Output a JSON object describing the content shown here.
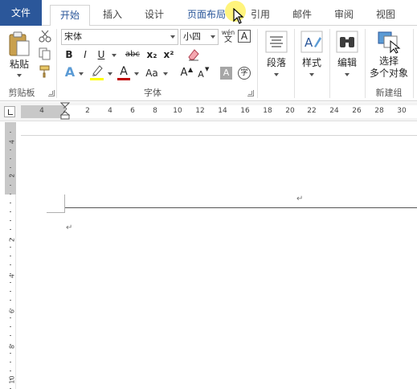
{
  "tabs": [
    {
      "label": "文件"
    },
    {
      "label": "开始"
    },
    {
      "label": "插入"
    },
    {
      "label": "设计"
    },
    {
      "label": "页面布局"
    },
    {
      "label": "引用"
    },
    {
      "label": "邮件"
    },
    {
      "label": "审阅"
    },
    {
      "label": "视图"
    }
  ],
  "ribbon": {
    "clipboard": {
      "paste_label": "粘贴",
      "group_label": "剪贴板"
    },
    "font": {
      "font_name": "宋体",
      "font_size": "小四",
      "bold": "B",
      "italic": "I",
      "underline": "U",
      "strikethrough": "abc",
      "subscript": "x₂",
      "superscript": "x²",
      "change_case": "Aa",
      "grow_font": "A",
      "shrink_font": "A",
      "group_label": "字体",
      "highlight_color": "#ffff00",
      "font_color": "#c00000"
    },
    "paragraph": {
      "label": "段落"
    },
    "styles": {
      "label": "样式"
    },
    "editing": {
      "label": "编辑"
    },
    "new_group": {
      "select_label_line1": "选择",
      "select_label_line2": "多个对象",
      "group_label": "新建组"
    }
  },
  "ruler": {
    "numbers": [
      "4",
      "2",
      "2",
      "4",
      "6",
      "8",
      "10",
      "12",
      "14",
      "16",
      "18",
      "20",
      "22",
      "24",
      "26",
      "28",
      "30"
    ]
  },
  "vertical_ruler": {
    "numbers": [
      "4",
      "2",
      "2",
      "4",
      "6",
      "8",
      "10"
    ]
  },
  "colors": {
    "accent": "#2b579a",
    "file_tab": "#2b579a",
    "highlight": "#ffff00",
    "font_red": "#c00000"
  },
  "document": {
    "paragraph_mark": "↵"
  }
}
